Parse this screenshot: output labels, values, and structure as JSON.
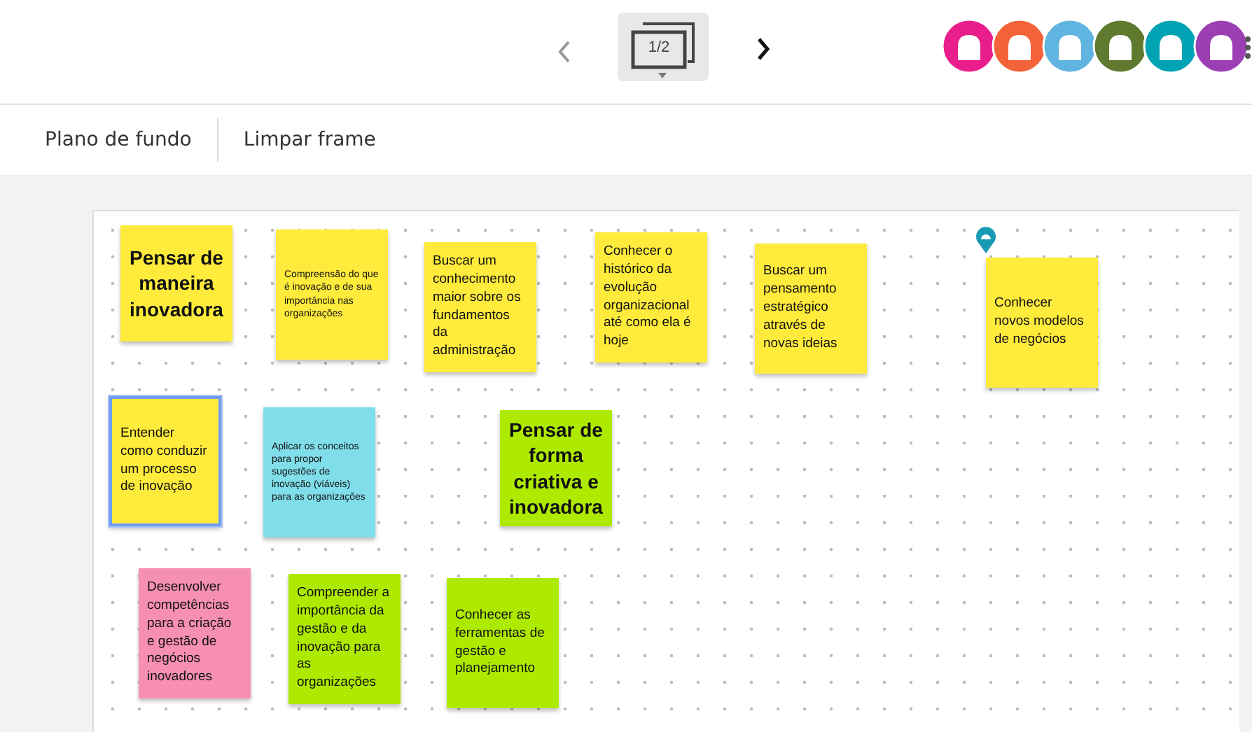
{
  "nav": {
    "previous": {
      "disabled": true
    },
    "page_indicator": "1/2",
    "next": {
      "disabled": false
    }
  },
  "avatars": [
    {
      "color": "#e91e8c"
    },
    {
      "color": "#f4623a"
    },
    {
      "color": "#5fb4e0"
    },
    {
      "color": "#5f7a2e"
    },
    {
      "color": "#00a3b4"
    },
    {
      "color": "#9c3fb5"
    }
  ],
  "toolbar": [
    "Plano de fundo",
    "Limpar frame"
  ],
  "notes": [
    {
      "text": "Pensar de maneira inovadora",
      "kind": "heading",
      "color": "#ffeb3b",
      "selected": false
    },
    {
      "text": "Compreensão do que é inovação e de sua importância nas organizações",
      "kind": "fine",
      "color": "#ffeb3b",
      "selected": false
    },
    {
      "text": "Buscar um conhecimento maior sobre os fundamentos da administração",
      "kind": "body",
      "color": "#ffeb3b",
      "selected": false
    },
    {
      "text": "Conhecer o histórico da evolução organizacional até como ela é hoje",
      "kind": "body",
      "color": "#ffeb3b",
      "selected": false
    },
    {
      "text": "Buscar um pensamento estratégico através de novas ideias",
      "kind": "body",
      "color": "#ffeb3b",
      "selected": false
    },
    {
      "text": "Conhecer novos modelos de negócios",
      "kind": "body",
      "color": "#ffeb3b",
      "selected": false,
      "pinned": true
    },
    {
      "text": "Entender como conduzir um processo de inovação",
      "kind": "body",
      "color": "#ffeb3b",
      "selected": true
    },
    {
      "text": "Aplicar os conceitos para propor sugestões de inovação (viáveis) para as organizações",
      "kind": "fine",
      "color": "#80deea",
      "selected": false
    },
    {
      "text": "Pensar de forma criativa e inovadora",
      "kind": "heading",
      "color": "#aeea00",
      "selected": false
    },
    {
      "text": "Desenvolver competências para a criação e gestão de negócios inovadores",
      "kind": "body",
      "color": "#f78fb3",
      "selected": false
    },
    {
      "text": "Compreender a importância da gestão e da inovação para as organizações",
      "kind": "body",
      "color": "#aeea00",
      "selected": false
    },
    {
      "text": "Conhecer as ferramentas de gestão e planejamento",
      "kind": "body",
      "color": "#aeea00",
      "selected": false
    }
  ]
}
